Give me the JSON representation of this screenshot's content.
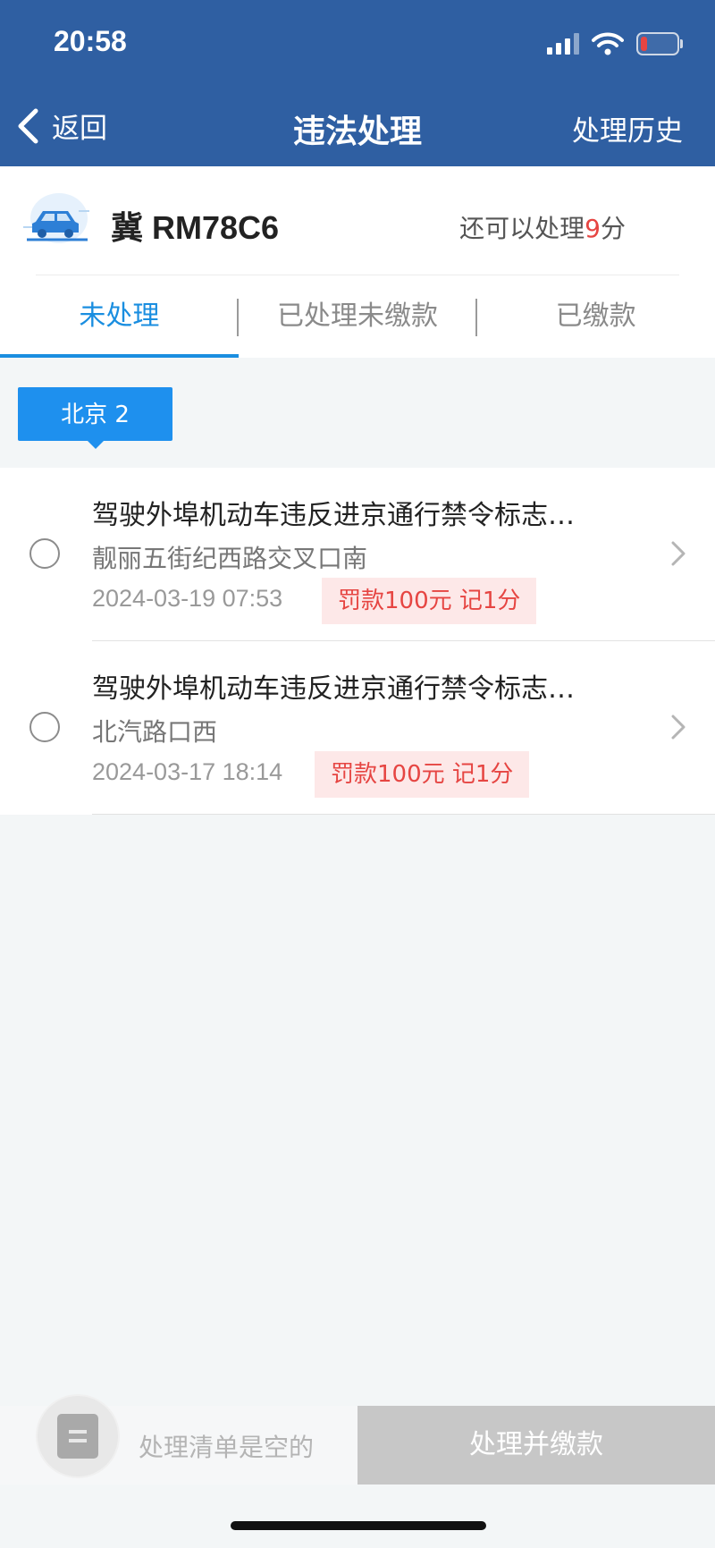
{
  "status_bar": {
    "time": "20:58"
  },
  "nav": {
    "back_label": "返回",
    "title": "违法处理",
    "history_label": "处理历史"
  },
  "vehicle": {
    "plate": "冀 RM78C6",
    "points_prefix": "还可以处理",
    "points_value": "9",
    "points_suffix": "分"
  },
  "tabs": [
    {
      "label": "未处理",
      "active": true
    },
    {
      "label": "已处理未缴款",
      "active": false
    },
    {
      "label": "已缴款",
      "active": false
    }
  ],
  "region": {
    "label": "北京 2"
  },
  "violations": [
    {
      "title": "驾驶外埠机动车违反进京通行禁令标志…",
      "location": "靓丽五街纪西路交叉口南",
      "time": "2024-03-19 07:53",
      "penalty": "罚款100元  记1分"
    },
    {
      "title": "驾驶外埠机动车违反进京通行禁令标志…",
      "location": "北汽路口西",
      "time": "2024-03-17 18:14",
      "penalty": "罚款100元  记1分"
    }
  ],
  "bottom": {
    "empty_text": "处理清单是空的",
    "pay_button": "处理并缴款"
  },
  "colors": {
    "header": "#2f5fa2",
    "accent": "#1a8ee0",
    "badge": "#1e90ee",
    "warning": "#e64542"
  }
}
